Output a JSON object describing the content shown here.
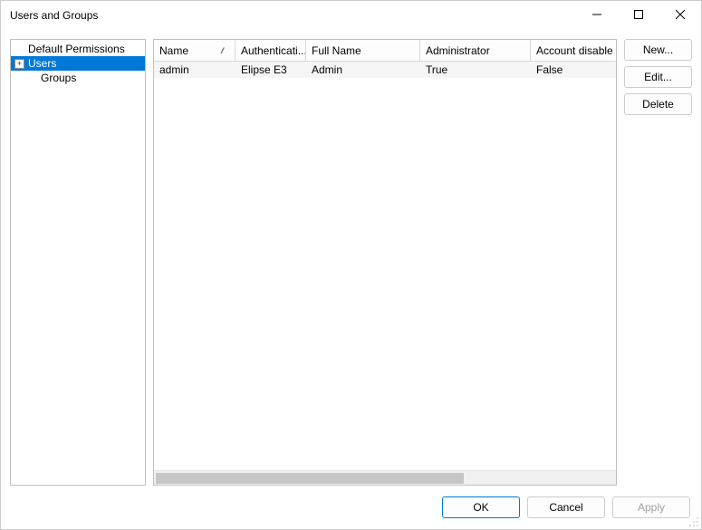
{
  "window": {
    "title": "Users and Groups"
  },
  "tree": {
    "items": [
      {
        "label": "Default Permissions",
        "level": 0,
        "selected": false,
        "expandable": false
      },
      {
        "label": "Users",
        "level": 0,
        "selected": true,
        "expandable": true
      },
      {
        "label": "Groups",
        "level": 1,
        "selected": false,
        "expandable": false
      }
    ]
  },
  "table": {
    "columns": [
      {
        "label": "Name",
        "sorted": true
      },
      {
        "label": "Authenticati...",
        "sorted": false
      },
      {
        "label": "Full Name",
        "sorted": false
      },
      {
        "label": "Administrator",
        "sorted": false
      },
      {
        "label": "Account disabled",
        "sorted": false
      }
    ],
    "rows": [
      {
        "cells": [
          "admin",
          "Elipse E3",
          "Admin",
          "True",
          "False"
        ]
      }
    ]
  },
  "side_buttons": {
    "new": "New...",
    "edit": "Edit...",
    "delete": "Delete"
  },
  "footer": {
    "ok": "OK",
    "cancel": "Cancel",
    "apply": "Apply"
  }
}
